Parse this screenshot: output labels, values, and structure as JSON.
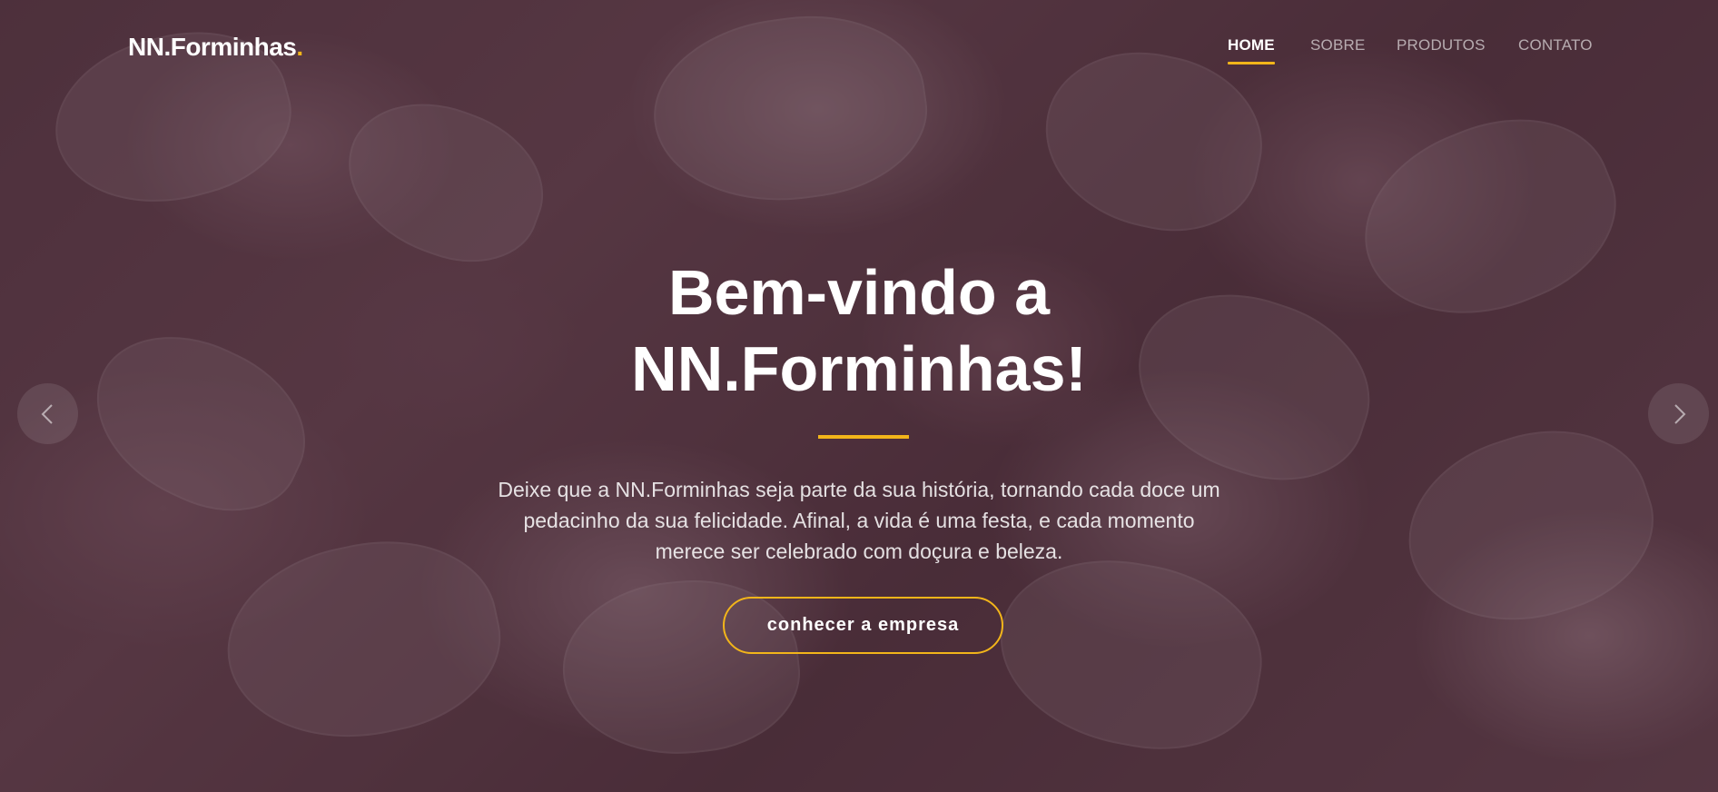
{
  "brand": {
    "name": "NN.Forminhas",
    "dot": ".",
    "accent_color": "#f2b51a"
  },
  "nav": {
    "items": [
      {
        "label": "HOME",
        "active": true
      },
      {
        "label": "SOBRE",
        "active": false
      },
      {
        "label": "PRODUTOS",
        "active": false
      },
      {
        "label": "CONTATO",
        "active": false
      }
    ]
  },
  "hero": {
    "title_line1": "Bem-vindo a",
    "title_line2": "NN.Forminhas!",
    "lead": "Deixe que a NN.Forminhas seja parte da sua história, tornando cada doce um pedacinho da sua felicidade. Afinal, a vida é uma festa, e cada momento merece ser celebrado com doçura e beleza.",
    "cta_label": "conhecer a empresa"
  },
  "carousel": {
    "prev_icon": "chevron-left-icon",
    "next_icon": "chevron-right-icon"
  }
}
